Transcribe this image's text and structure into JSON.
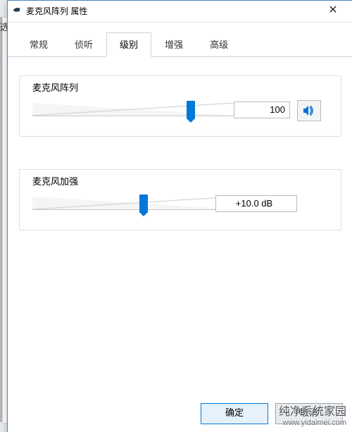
{
  "window": {
    "title": "麦克风阵列 属性"
  },
  "left_fragment": "选",
  "tabs": {
    "items": [
      {
        "label": "常规"
      },
      {
        "label": "侦听"
      },
      {
        "label": "级别"
      },
      {
        "label": "增强"
      },
      {
        "label": "高级"
      }
    ],
    "active_index": 2
  },
  "levels_group": {
    "label": "麦克风阵列",
    "value_text": "100",
    "slider_percent": 78
  },
  "boost_group": {
    "label": "麦克风加强",
    "value_text": "+10.0 dB",
    "slider_percent": 55
  },
  "buttons": {
    "ok": "确定",
    "cancel": "取消"
  },
  "icons": {
    "speaker": "speaker-icon",
    "mic": "microphone-icon",
    "close": "close-icon"
  },
  "watermark": {
    "line1": "纯净系统家园",
    "line2": "www.yidaimei.com"
  }
}
